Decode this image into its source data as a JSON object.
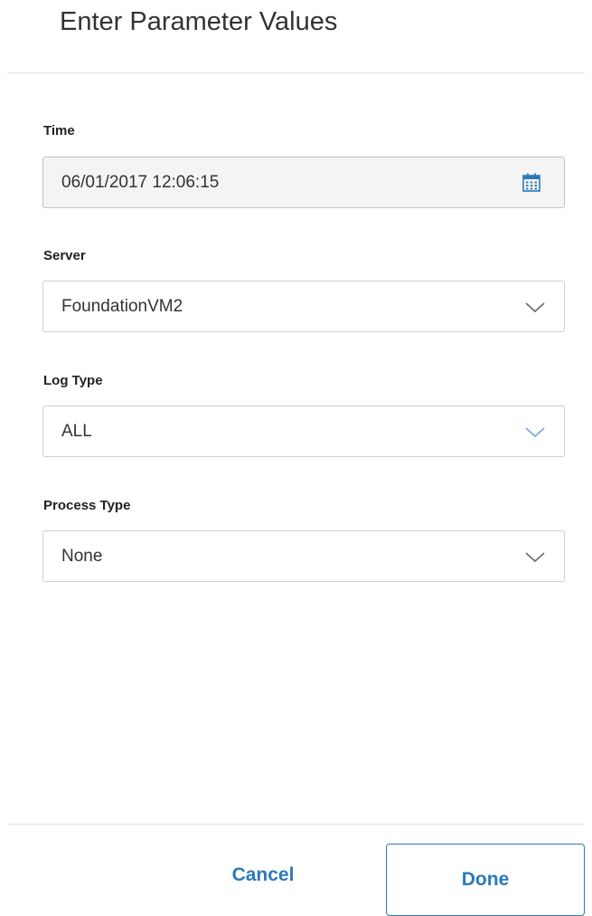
{
  "dialog": {
    "title": "Enter Parameter Values"
  },
  "fields": {
    "time": {
      "label": "Time",
      "value": "06/01/2017 12:06:15",
      "icon": "calendar-icon"
    },
    "server": {
      "label": "Server",
      "value": "FoundationVM2",
      "icon": "chevron-down-icon"
    },
    "log_type": {
      "label": "Log Type",
      "value": "ALL",
      "icon": "chevron-down-icon"
    },
    "process_type": {
      "label": "Process Type",
      "value": "None",
      "icon": "chevron-down-icon"
    }
  },
  "footer": {
    "cancel_label": "Cancel",
    "done_label": "Done"
  },
  "colors": {
    "accent": "#2b7ab8",
    "chevron_default": "#6b6b6b",
    "chevron_active": "#7aa6d6",
    "divider": "#e4e4e4"
  }
}
